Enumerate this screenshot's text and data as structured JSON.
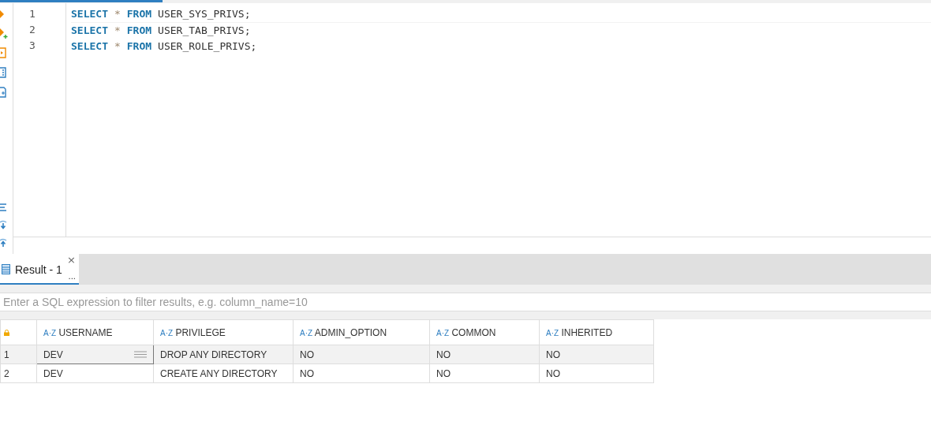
{
  "editor": {
    "lines": [
      {
        "number": "1",
        "tokens": [
          {
            "kind": "keyword",
            "text": "SELECT"
          },
          {
            "kind": "operator",
            "text": "*"
          },
          {
            "kind": "keyword",
            "text": "FROM"
          },
          {
            "kind": "plain",
            "text": "USER_SYS_PRIVS;"
          }
        ]
      },
      {
        "number": "2",
        "tokens": [
          {
            "kind": "keyword",
            "text": "SELECT"
          },
          {
            "kind": "operator",
            "text": "*"
          },
          {
            "kind": "keyword",
            "text": "FROM"
          },
          {
            "kind": "plain",
            "text": "USER_TAB_PRIVS;"
          }
        ]
      },
      {
        "number": "3",
        "tokens": [
          {
            "kind": "keyword",
            "text": "SELECT"
          },
          {
            "kind": "operator",
            "text": "*"
          },
          {
            "kind": "keyword",
            "text": "FROM"
          },
          {
            "kind": "plain",
            "text": "USER_ROLE_PRIVS;"
          }
        ]
      }
    ]
  },
  "results": {
    "tabs": [
      {
        "label": "Result - 1",
        "close": "×",
        "more": "...",
        "selected": true
      }
    ],
    "filter": {
      "placeholder": "Enter a SQL expression to filter results, e.g. column_name=10"
    },
    "table": {
      "columns": [
        {
          "label": "USERNAME",
          "type": "A·Z"
        },
        {
          "label": "PRIVILEGE",
          "type": "A·Z"
        },
        {
          "label": "ADMIN_OPTION",
          "type": "A·Z"
        },
        {
          "label": "COMMON",
          "type": "A·Z"
        },
        {
          "label": "INHERITED",
          "type": "A·Z"
        }
      ],
      "rows": [
        {
          "number": "1",
          "selected": true,
          "cells": [
            "DEV",
            "DROP ANY DIRECTORY",
            "NO",
            "NO",
            "NO"
          ]
        },
        {
          "number": "2",
          "selected": false,
          "cells": [
            "DEV",
            "CREATE ANY DIRECTORY",
            "NO",
            "NO",
            "NO"
          ]
        }
      ]
    }
  }
}
